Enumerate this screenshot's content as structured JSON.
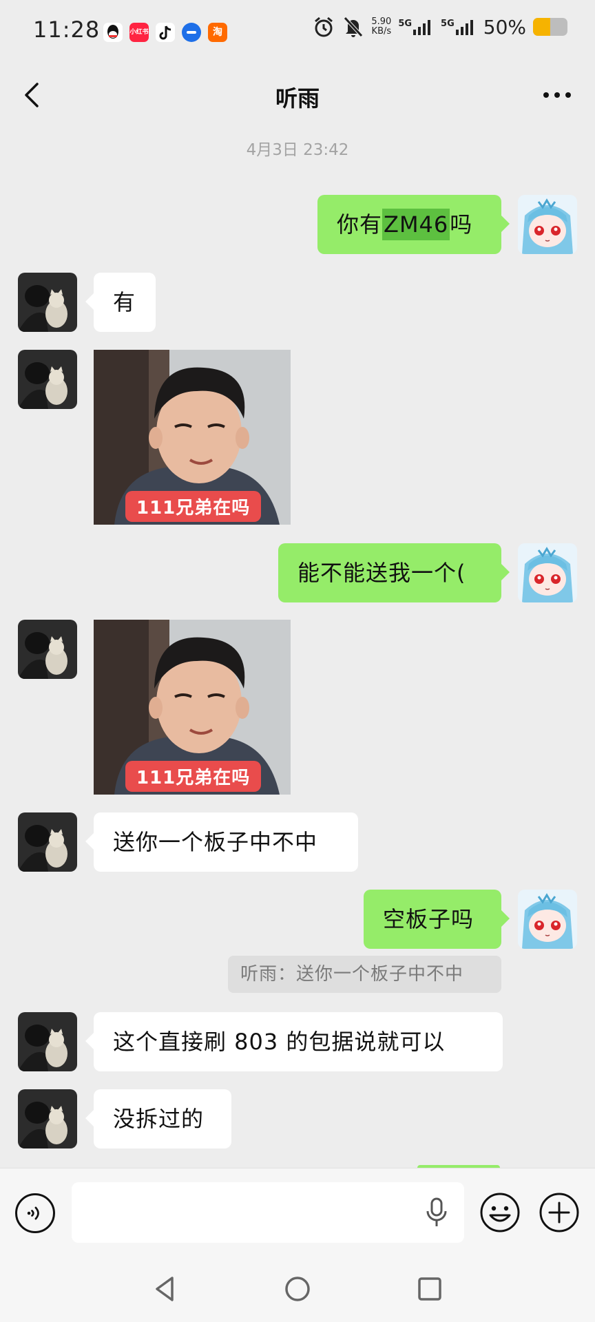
{
  "status_bar": {
    "time": "11:28",
    "net_speed_value": "5.90",
    "net_speed_unit": "KB/s",
    "signal_1": "5G",
    "signal_2": "5G",
    "battery_percent": "50%",
    "battery_level": 0.5,
    "app_icons": [
      "qq-icon",
      "xiaohongshu-icon",
      "douyin-icon",
      "message-icon",
      "taobao-icon"
    ],
    "taobao_label": "淘",
    "xhs_label": "小红书"
  },
  "header": {
    "title": "听雨",
    "back_icon": "chevron-left-icon",
    "more_icon": "more-dots-icon"
  },
  "timestamp": "4月3日 23:42",
  "messages": {
    "m1_pre": "你有",
    "m1_highlight": "ZM46",
    "m1_post": "吗",
    "m2": "有",
    "m3_caption": "111兄弟在吗",
    "m4": "能不能送我一个(",
    "m5_caption": "111兄弟在吗",
    "m6": "送你一个板子中不中",
    "m7": "空板子吗",
    "m7_quote": "听雨：送你一个板子中不中",
    "m8": "这个直接刷 803 的包据说就可以",
    "m9": "没拆过的"
  },
  "input_bar": {
    "placeholder": "",
    "voice_icon": "voice-icon",
    "mic_icon": "microphone-icon",
    "emoji_icon": "emoji-icon",
    "plus_icon": "plus-icon"
  },
  "colors": {
    "background": "#ededed",
    "outgoing_bubble": "#95ec69",
    "incoming_bubble": "#ffffff",
    "highlight": "#5dc040",
    "sticker_caption": "#e94c4c"
  }
}
